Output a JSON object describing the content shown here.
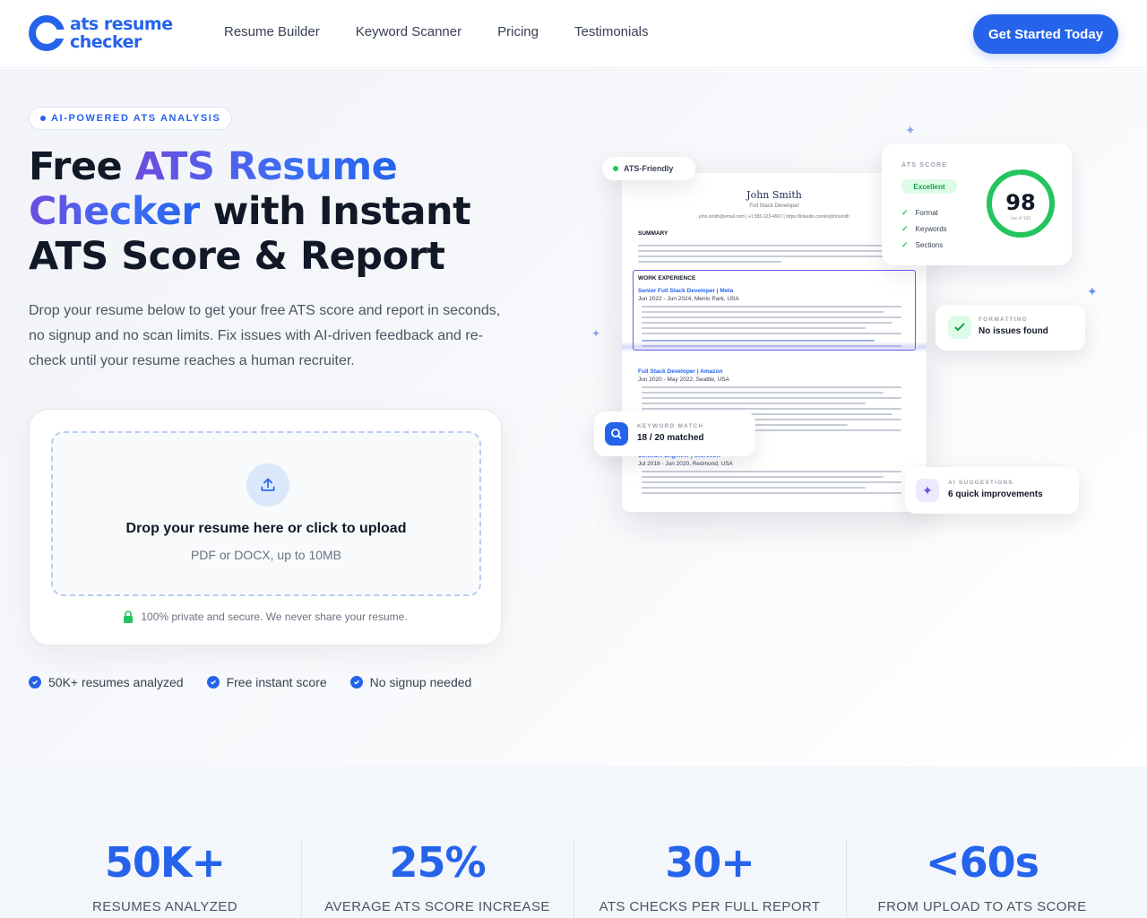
{
  "nav": {
    "logo_line1": "ats resume",
    "logo_line2": "checker",
    "links": [
      "Resume Builder",
      "Keyword Scanner",
      "Pricing",
      "Testimonials"
    ],
    "cta_label": "Get Started Today"
  },
  "hero": {
    "pill": "AI-POWERED ATS ANALYSIS",
    "headline": {
      "part1": "Free ",
      "highlight1": "ATS Resume",
      "highlight2": "Checker",
      "part2": " with Instant",
      "part3": "ATS Score & Report"
    },
    "subtitle": "Drop your resume below to get your free ATS score and report in seconds, no signup and no scan limits. Fix issues with AI-driven feedback and re-check until your resume reaches a human recruiter.",
    "upload": {
      "title": "Drop your resume here or click to upload",
      "subtitle": "PDF or DOCX, up to 10MB",
      "secure_note": "100% private and secure. We never share your resume."
    },
    "checks": [
      "50K+ resumes analyzed",
      "Free instant score",
      "No signup needed"
    ]
  },
  "illustration": {
    "ats_friendly": "ATS-Friendly",
    "resume": {
      "name": "John Smith",
      "role": "Full Stack Developer",
      "contact": "john.smith@email.com | +1 555-123-4567 | https://linkedin.com/in/johnsmith",
      "summary_heading": "SUMMARY",
      "work_heading": "WORK EXPERIENCE",
      "job1": "Senior Full Stack Developer | Meta",
      "job1_dates": "Jun 2022 - Jun 2024, Menlo Park, USA",
      "job2": "Full Stack Developer | Amazon",
      "job2_dates": "Jun 2020 - May 2022, Seattle, USA",
      "job3": "Software Engineer | Microsoft",
      "job3_dates": "Jul 2018 - Jun 2020, Redmond, USA"
    },
    "score_card": {
      "label": "ATS SCORE",
      "status": "Excellent",
      "checks": [
        "Format",
        "Keywords",
        "Sections"
      ],
      "score": "98",
      "score_of": "out of 100",
      "score_fraction": 0.98
    },
    "formatting": {
      "label": "FORMATTING",
      "value": "No issues found"
    },
    "keyword": {
      "label": "KEYWORD MATCH",
      "value": "18 / 20 matched"
    },
    "ai": {
      "label": "AI SUGGESTIONS",
      "value": "6 quick improvements"
    }
  },
  "stats": [
    {
      "value": "50K+",
      "label": "RESUMES ANALYZED"
    },
    {
      "value": "25%",
      "label": "AVERAGE ATS SCORE INCREASE"
    },
    {
      "value": "30+",
      "label": "ATS CHECKS PER FULL REPORT"
    },
    {
      "value": "<60s",
      "label": "FROM UPLOAD TO ATS SCORE"
    }
  ],
  "colors": {
    "brand": "#2563eb",
    "success": "#22c55e",
    "accent_purple": "#6d4de0"
  }
}
